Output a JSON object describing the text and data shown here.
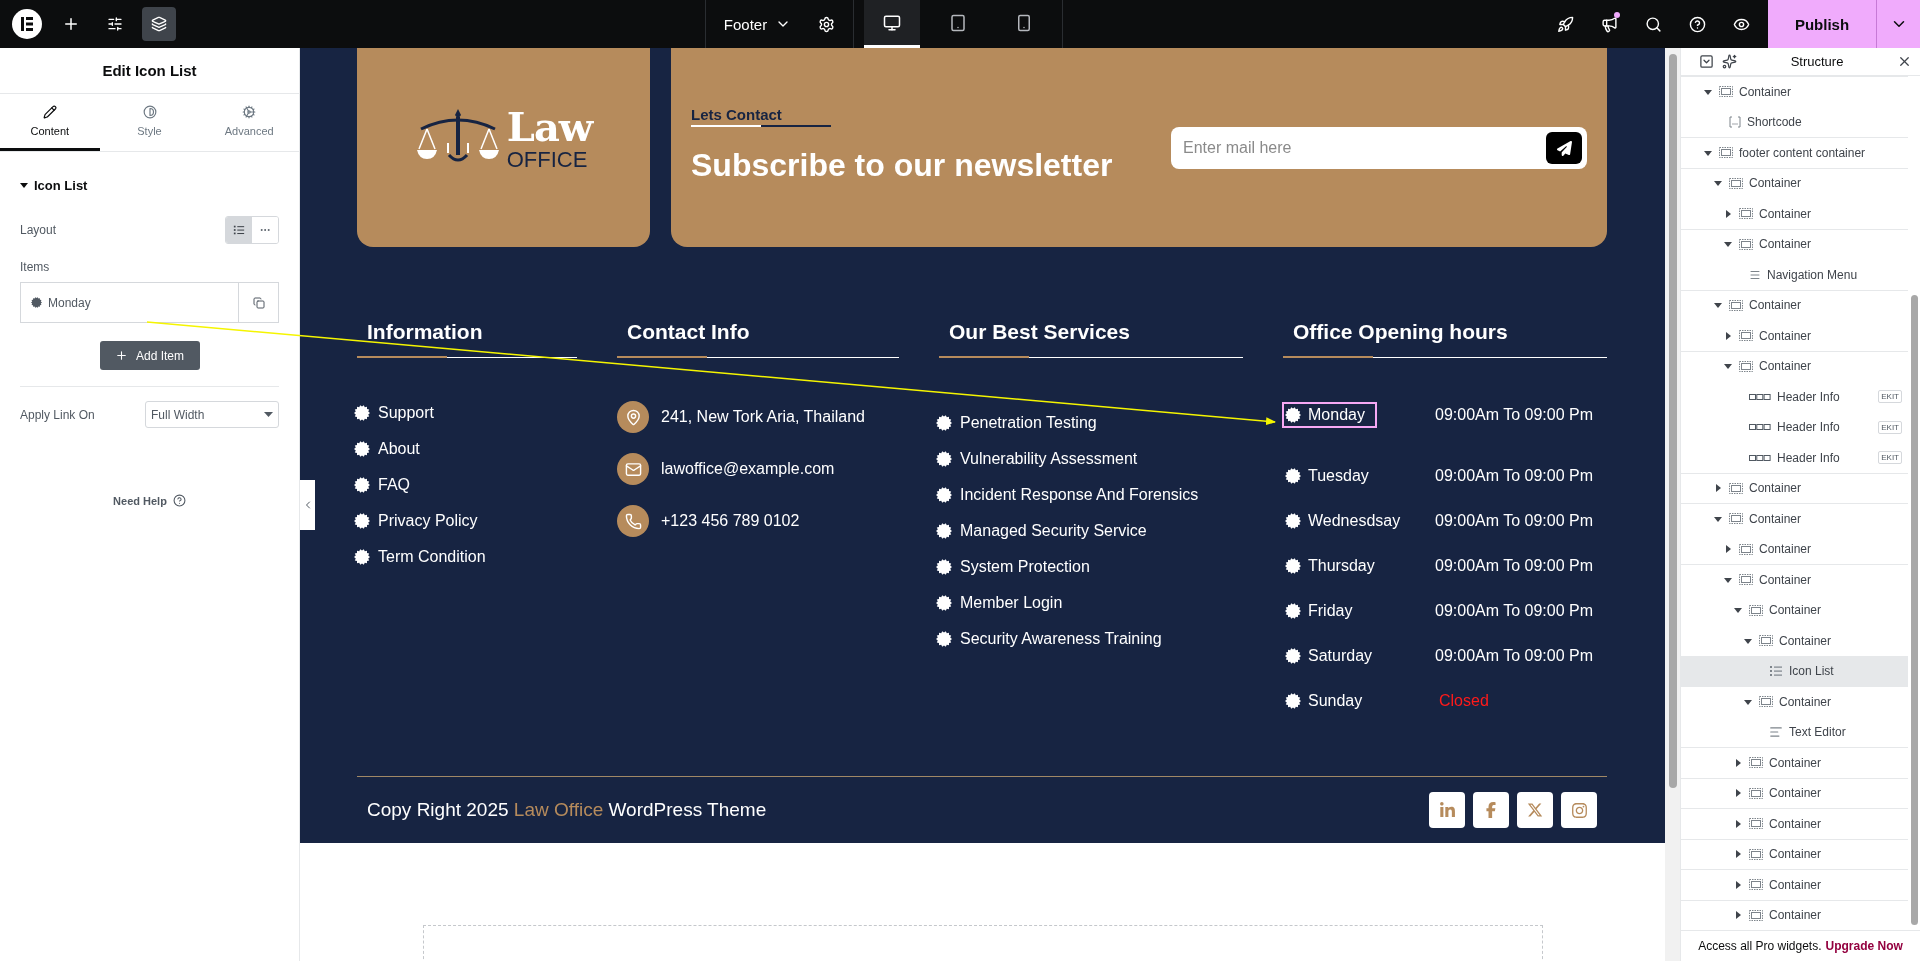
{
  "topbar": {
    "document": "Footer",
    "devices": [
      {
        "kind": "desktop",
        "selected": true
      },
      {
        "kind": "tablet",
        "selected": false
      },
      {
        "kind": "mobile",
        "selected": false
      }
    ],
    "publish": "Publish"
  },
  "panel": {
    "title": "Edit Icon List",
    "tabs": [
      {
        "label": "Content",
        "kind": "content",
        "selected": true
      },
      {
        "label": "Style",
        "kind": "style",
        "selected": false
      },
      {
        "label": "Advanced",
        "kind": "advanced",
        "selected": false
      }
    ],
    "section": {
      "title": "Icon List",
      "expanded": true
    },
    "layout_label": "Layout",
    "layout_options": [
      {
        "kind": "list",
        "selected": true
      },
      {
        "kind": "inline",
        "selected": false
      }
    ],
    "items_label": "Items",
    "items": [
      {
        "label": "Monday"
      }
    ],
    "add_item": "Add Item",
    "apply_link": {
      "label": "Apply Link On",
      "value": "Full Width"
    },
    "help": "Need Help"
  },
  "footer": {
    "logo": {
      "word1": "Law",
      "word2": "OFFICE"
    },
    "newsletter": {
      "eyebrow": "Lets Contact",
      "title": "Subscribe to our newsletter",
      "placeholder": "Enter mail here"
    },
    "information": {
      "heading": "Information",
      "items": [
        "Support",
        "About",
        "FAQ",
        "Privacy Policy",
        "Term Condition"
      ]
    },
    "contact": {
      "heading": "Contact Info",
      "items": [
        {
          "kind": "location",
          "text": "241, New Tork Aria, Thailand"
        },
        {
          "kind": "email",
          "text": "lawoffice@example.com"
        },
        {
          "kind": "phone",
          "text": "+123 456 789 0102"
        }
      ]
    },
    "services": {
      "heading": "Our Best Services",
      "items": [
        "Penetration Testing",
        "Vulnerability Assessment",
        "Incident Response And Forensics",
        "Managed Security Service",
        "System Protection",
        "Member Login",
        "Security Awareness Training"
      ]
    },
    "hours": {
      "heading": "Office Opening hours",
      "rows": [
        {
          "day": "Monday",
          "time": "09:00Am To 09:00 Pm",
          "closed": false,
          "selected": true
        },
        {
          "day": "Tuesday",
          "time": "09:00Am To 09:00 Pm",
          "closed": false,
          "selected": false
        },
        {
          "day": "Wednesdsay",
          "time": "09:00Am To 09:00 Pm",
          "closed": false,
          "selected": false
        },
        {
          "day": "Thursday",
          "time": "09:00Am To 09:00 Pm",
          "closed": false,
          "selected": false
        },
        {
          "day": "Friday",
          "time": "09:00Am To 09:00 Pm",
          "closed": false,
          "selected": false
        },
        {
          "day": "Saturday",
          "time": "09:00Am To 09:00 Pm",
          "closed": false,
          "selected": false
        },
        {
          "day": "Sunday",
          "time": "Closed",
          "closed": true,
          "selected": false
        }
      ]
    },
    "copyright": {
      "before": "Copy Right 2025",
      "brand": "Law Office",
      "after": "WordPress Theme"
    },
    "socials": [
      {
        "kind": "linkedin"
      },
      {
        "kind": "facebook"
      },
      {
        "kind": "x"
      },
      {
        "kind": "instagram"
      }
    ]
  },
  "structure": {
    "title": "Structure",
    "tree": [
      {
        "label": "Container",
        "kind": "container",
        "expanded": true,
        "selected": false,
        "children": [
          {
            "label": "Shortcode",
            "kind": "shortcode",
            "selected": false
          }
        ]
      },
      {
        "label": "footer content container",
        "kind": "container",
        "expanded": true,
        "selected": false,
        "children": [
          {
            "label": "Container",
            "kind": "container",
            "expanded": true,
            "selected": false,
            "children": [
              {
                "label": "Container",
                "kind": "container",
                "expanded": false,
                "selected": false
              },
              {
                "label": "Container",
                "kind": "container",
                "expanded": true,
                "selected": false,
                "children": [
                  {
                    "label": "Navigation Menu",
                    "kind": "menu",
                    "selected": false
                  }
                ]
              }
            ]
          },
          {
            "label": "Container",
            "kind": "container",
            "expanded": true,
            "selected": false,
            "children": [
              {
                "label": "Container",
                "kind": "container",
                "expanded": false,
                "selected": false
              },
              {
                "label": "Container",
                "kind": "container",
                "expanded": true,
                "selected": false,
                "children": [
                  {
                    "label": "Header Info",
                    "kind": "header-info",
                    "badge": "EKIT",
                    "selected": false
                  },
                  {
                    "label": "Header Info",
                    "kind": "header-info",
                    "badge": "EKIT",
                    "selected": false
                  },
                  {
                    "label": "Header Info",
                    "kind": "header-info",
                    "badge": "EKIT",
                    "selected": false
                  }
                ]
              }
            ]
          },
          {
            "label": "Container",
            "kind": "container",
            "expanded": false,
            "selected": false
          },
          {
            "label": "Container",
            "kind": "container",
            "expanded": true,
            "selected": false,
            "children": [
              {
                "label": "Container",
                "kind": "container",
                "expanded": false,
                "selected": false
              },
              {
                "label": "Container",
                "kind": "container",
                "expanded": true,
                "selected": false,
                "children": [
                  {
                    "label": "Container",
                    "kind": "container",
                    "expanded": true,
                    "selected": false,
                    "children": [
                      {
                        "label": "Container",
                        "kind": "container",
                        "expanded": true,
                        "selected": false,
                        "children": [
                          {
                            "label": "Icon List",
                            "kind": "icon-list",
                            "selected": true
                          }
                        ]
                      },
                      {
                        "label": "Container",
                        "kind": "container",
                        "expanded": true,
                        "selected": false,
                        "children": [
                          {
                            "label": "Text Editor",
                            "kind": "text-editor",
                            "selected": false
                          }
                        ]
                      }
                    ]
                  },
                  {
                    "label": "Container",
                    "kind": "container",
                    "expanded": false,
                    "selected": false
                  },
                  {
                    "label": "Container",
                    "kind": "container",
                    "expanded": false,
                    "selected": false
                  },
                  {
                    "label": "Container",
                    "kind": "container",
                    "expanded": false,
                    "selected": false
                  },
                  {
                    "label": "Container",
                    "kind": "container",
                    "expanded": false,
                    "selected": false
                  },
                  {
                    "label": "Container",
                    "kind": "container",
                    "expanded": false,
                    "selected": false
                  },
                  {
                    "label": "Container",
                    "kind": "container",
                    "expanded": false,
                    "selected": false
                  }
                ]
              }
            ]
          }
        ]
      }
    ],
    "promo": {
      "text": "Access all Pro widgets.",
      "link": "Upgrade Now"
    }
  }
}
